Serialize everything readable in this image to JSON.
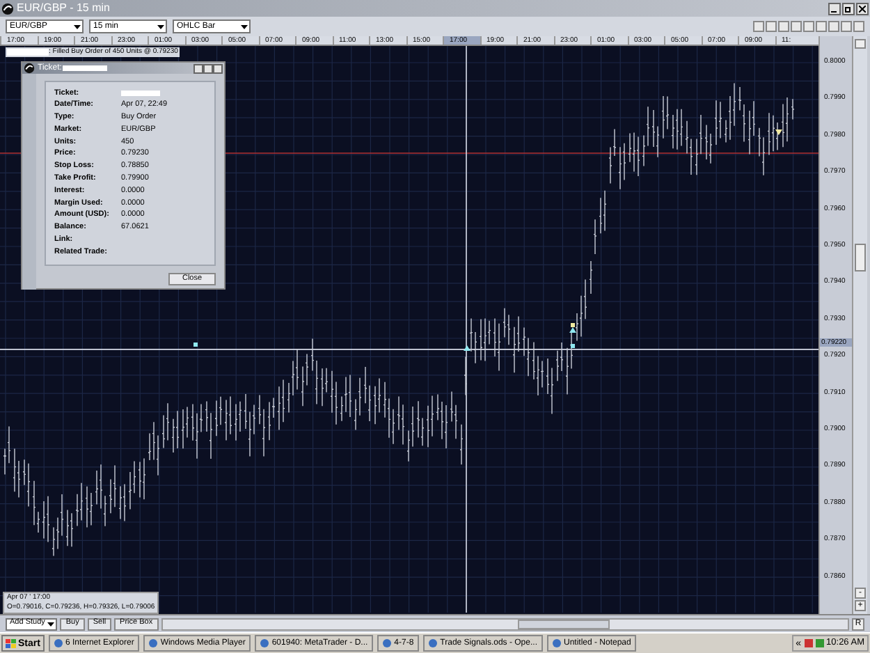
{
  "window": {
    "title": "EUR/GBP - 15 min"
  },
  "toolbar": {
    "dropdowns": [
      {
        "value": "EUR/GBP"
      },
      {
        "value": "15 min"
      },
      {
        "value": "OHLC Bar"
      }
    ]
  },
  "time_axis": {
    "labels": [
      {
        "text": "17:00",
        "selected": false
      },
      {
        "text": "19:00",
        "selected": false
      },
      {
        "text": "21:00",
        "selected": false
      },
      {
        "text": "23:00",
        "selected": false
      },
      {
        "text": "01:00",
        "selected": false
      },
      {
        "text": "03:00",
        "selected": false
      },
      {
        "text": "05:00",
        "selected": false
      },
      {
        "text": "07:00",
        "selected": false
      },
      {
        "text": "09:00",
        "selected": false
      },
      {
        "text": "11:00",
        "selected": false
      },
      {
        "text": "13:00",
        "selected": false
      },
      {
        "text": "15:00",
        "selected": false
      },
      {
        "text": "17:00",
        "selected": true
      },
      {
        "text": "19:00",
        "selected": false
      },
      {
        "text": "21:00",
        "selected": false
      },
      {
        "text": "23:00",
        "selected": false
      },
      {
        "text": "01:00",
        "selected": false
      },
      {
        "text": "03:00",
        "selected": false
      },
      {
        "text": "05:00",
        "selected": false
      },
      {
        "text": "07:00",
        "selected": false
      },
      {
        "text": "09:00",
        "selected": false
      },
      {
        "text": "11:",
        "selected": false
      }
    ]
  },
  "order_label": {
    "text": ": Filled Buy Order of 450 Units @ 0.79230"
  },
  "ticket": {
    "title": "Ticket:",
    "fields": [
      {
        "label": "Ticket:"
      },
      {
        "label": "Date/Time:",
        "value": "Apr 07, 22:49"
      },
      {
        "label": "Type:",
        "value": "Buy Order"
      },
      {
        "label": "Market:",
        "value": "EUR/GBP"
      },
      {
        "label": "Units:",
        "value": "450"
      },
      {
        "label": "Price:",
        "value": "0.79230"
      },
      {
        "label": "Stop Loss:",
        "value": "0.78850"
      },
      {
        "label": "Take Profit:",
        "value": "0.79900"
      },
      {
        "label": "Interest:",
        "value": "0.0000"
      },
      {
        "label": "Margin Used:",
        "value": "0.0000"
      },
      {
        "label": "Amount (USD):",
        "value": "0.0000"
      },
      {
        "label": "Balance:",
        "value": "67.0621"
      },
      {
        "label": "Link:"
      },
      {
        "label": "Related Trade:"
      }
    ],
    "button": "Close"
  },
  "price_axis": {
    "labels": [
      "0.8000",
      "0.7990",
      "0.7980",
      "0.7970",
      "0.7960",
      "0.7950",
      "0.7940",
      "0.7930",
      "0.7920",
      "0.7910",
      "0.7900",
      "0.7890",
      "0.7880",
      "0.7870",
      "0.7860"
    ],
    "current": "0.79220"
  },
  "info_box": {
    "lines": [
      "Apr 07 ' 17:00",
      "O=0.79016, C=0.79236, H=0.79326, L=0.79006"
    ]
  },
  "bottom_bar": {
    "study": "Add Study",
    "buttons": [
      "Buy",
      "Sell",
      "Price Box"
    ],
    "zoom_buttons": [
      "-",
      "+",
      "R"
    ]
  },
  "taskbar": {
    "start": "Start",
    "tasks": [
      "6 Internet Explorer",
      "Windows Media Player",
      "601940: MetaTrader - D...",
      "4-7-8",
      "Trade Signals.ods - Ope...",
      "Untitled - Notepad"
    ],
    "tray": "«",
    "time": "10:26 AM"
  }
}
